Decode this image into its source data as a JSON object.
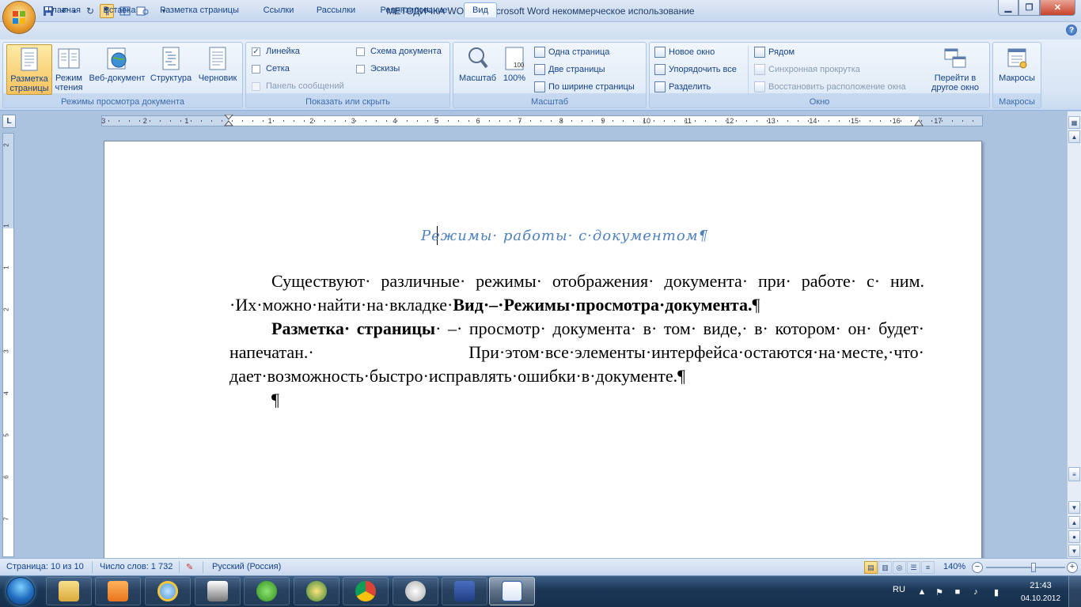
{
  "window": {
    "title": "МЕТОДИЧКА WORD - Microsoft Word некоммерческое использование",
    "min_icon": "minimize-icon",
    "max_icon": "restore-icon",
    "close_icon": "close-icon"
  },
  "qat": [
    "save-icon",
    "undo-icon",
    "redo-icon",
    "pilcrow-icon",
    "table-icon",
    "print-preview-icon",
    "customize-icon"
  ],
  "tabs": [
    "Главная",
    "Вставка",
    "Разметка страницы",
    "Ссылки",
    "Рассылки",
    "Рецензирование",
    "Вид"
  ],
  "active_tab": "Вид",
  "ribbon": {
    "views": {
      "label": "Режимы просмотра документа",
      "buttons": [
        {
          "line1": "Разметка",
          "line2": "страницы"
        },
        {
          "line1": "Режим",
          "line2": "чтения"
        },
        {
          "line1": "Веб-документ",
          "line2": ""
        },
        {
          "line1": "Структура",
          "line2": ""
        },
        {
          "line1": "Черновик",
          "line2": ""
        }
      ]
    },
    "show": {
      "label": "Показать или скрыть",
      "ruler": "Линейка",
      "grid": "Сетка",
      "msgbar": "Панель сообщений",
      "docmap": "Схема документа",
      "thumbs": "Эскизы"
    },
    "zoom": {
      "label": "Масштаб",
      "zoom_btn": "Масштаб",
      "hundred": "100%",
      "hundred_icon_text": "100",
      "one_page": "Одна страница",
      "two_pages": "Две страницы",
      "page_width": "По ширине страницы"
    },
    "window": {
      "label": "Окно",
      "new_window": "Новое окно",
      "arrange_all": "Упорядочить все",
      "split": "Разделить",
      "side_by_side": "Рядом",
      "sync_scroll": "Синхронная прокрутка",
      "reset_pos": "Восстановить расположение окна",
      "switch_line1": "Перейти в",
      "switch_line2": "другое окно"
    },
    "macros": {
      "label": "Макросы",
      "button": "Макросы"
    }
  },
  "ruler": {
    "h_numbers": [
      "3",
      "2",
      "1",
      "1",
      "2",
      "3",
      "4",
      "5",
      "6",
      "7",
      "8",
      "9",
      "10",
      "11",
      "12",
      "13",
      "14",
      "15",
      "16",
      "17"
    ],
    "v_numbers": [
      "2",
      "1",
      "1",
      "2",
      "3",
      "4",
      "5",
      "6",
      "7"
    ],
    "corner": "L"
  },
  "document": {
    "heading": "Режимы· работы· с·документом¶",
    "p1_text": "Существуют· различные· режимы· отображения· документа· при· работе· с· ним. ·Их·можно·найти·на·вкладке·",
    "p1_bold": "Вид·–·Режимы·просмотра·документа.",
    "p1_end": "¶",
    "p2_bold": "Разметка· страницы",
    "p2_text": "· –· просмотр· документа· в· том· виде,· в· котором· он· будет· напечатан.· При·этом·все·элементы·интерфейса·остаются·на·месте,·что· дает·возможность·быстро·исправлять·ошибки·в·документе.¶",
    "p3": "¶"
  },
  "status": {
    "page": "Страница: 10 из 10",
    "words": "Число слов: 1 732",
    "lang": "Русский (Россия)",
    "zoom": "140%",
    "zoom_level_percent": 140
  },
  "taskbar": {
    "apps": [
      "folder-icon",
      "media-player-icon",
      "internet-explorer-icon",
      "scanner-icon",
      "utorrent-icon",
      "media-center-icon",
      "chrome-icon",
      "webcam-icon",
      "save-disk-icon",
      "word-icon"
    ],
    "active": "word-icon",
    "lang": "RU",
    "time": "21:43",
    "date": "04.10.2012"
  }
}
